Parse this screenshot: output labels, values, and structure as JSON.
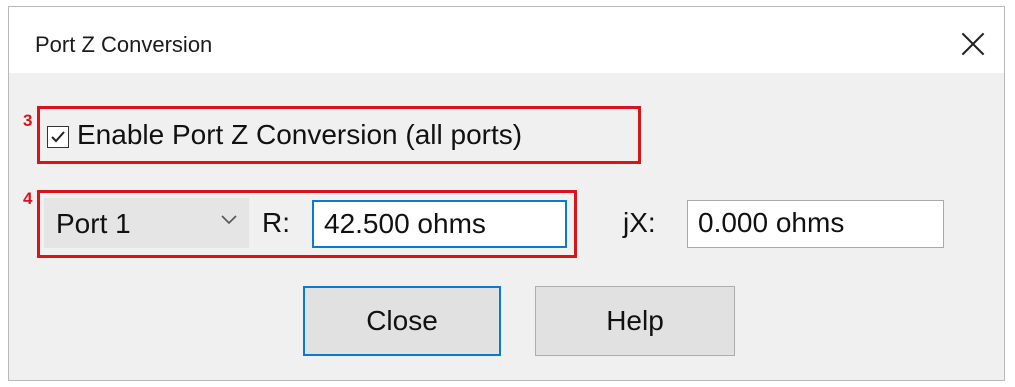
{
  "dialog": {
    "title": "Port Z Conversion"
  },
  "annotations": {
    "marker3": "3",
    "marker4": "4"
  },
  "enable": {
    "label": "Enable Port Z Conversion (all ports)",
    "checked": true
  },
  "port": {
    "selected": "Port 1",
    "r_label": "R:",
    "r_value": "42.500 ohms",
    "jx_label": "jX:",
    "jx_value": "0.000 ohms"
  },
  "buttons": {
    "close": "Close",
    "help": "Help"
  },
  "icons": {
    "window_close": "close-icon",
    "checkbox": "checkmark-icon",
    "dropdown": "chevron-down-icon"
  },
  "colors": {
    "annotation": "#d6141b",
    "focus": "#0a7ad1"
  }
}
